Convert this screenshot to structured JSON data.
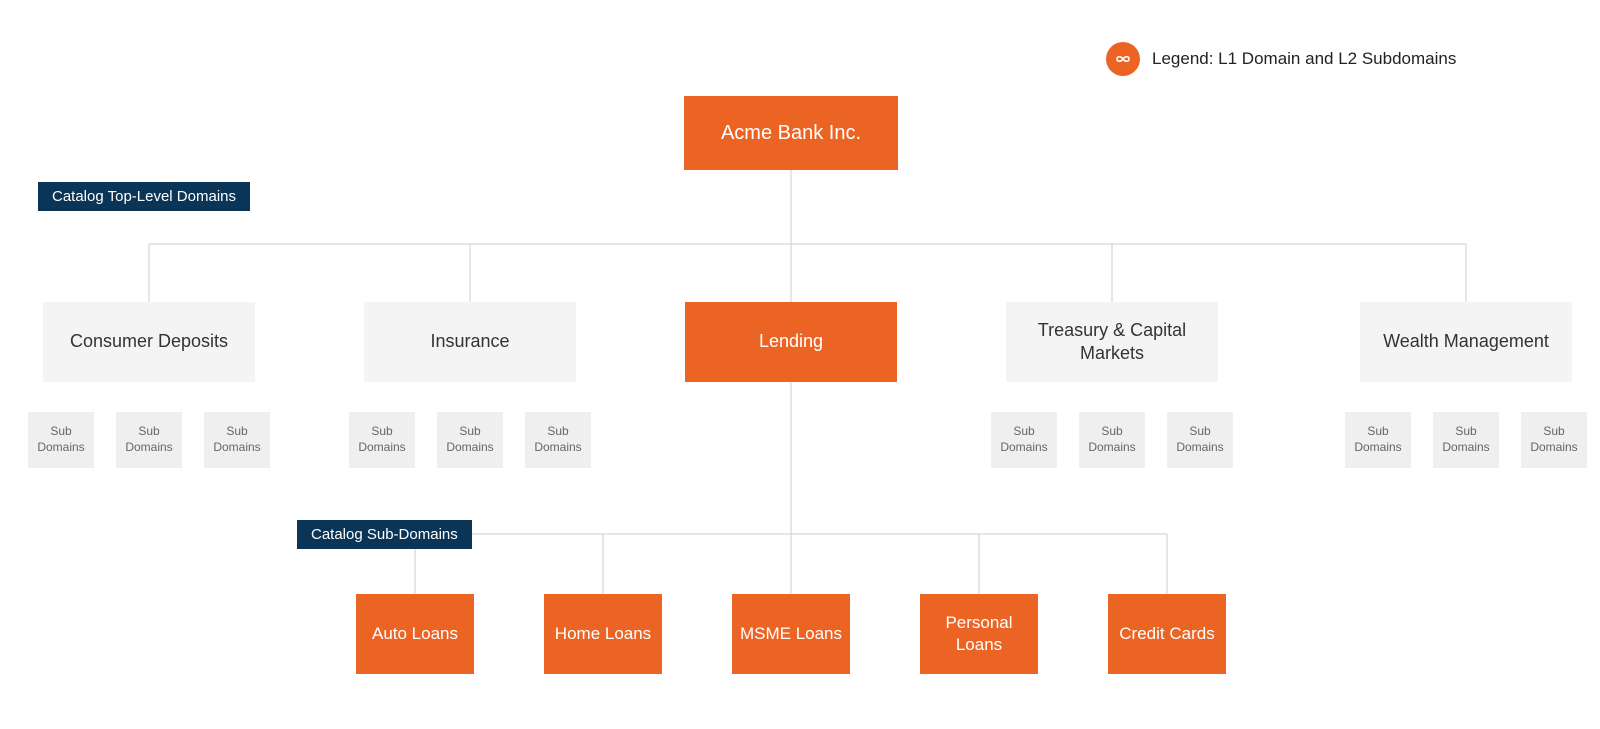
{
  "legend": {
    "text": "Legend: L1 Domain and L2 Subdomains"
  },
  "tags": {
    "top": "Catalog Top-Level Domains",
    "sub": "Catalog Sub-Domains"
  },
  "root": {
    "label": "Acme Bank Inc."
  },
  "topDomains": [
    {
      "label": "Consumer Deposits",
      "active": false
    },
    {
      "label": "Insurance",
      "active": false
    },
    {
      "label": "Lending",
      "active": true
    },
    {
      "label": "Treasury & Capital Markets",
      "active": false
    },
    {
      "label": "Wealth Management",
      "active": false
    }
  ],
  "subLabel": "Sub Domains",
  "lendingSubs": [
    {
      "label": "Auto Loans"
    },
    {
      "label": "Home Loans"
    },
    {
      "label": "MSME Loans"
    },
    {
      "label": "Personal Loans"
    },
    {
      "label": "Credit Cards"
    }
  ],
  "colors": {
    "accent": "#EB6424",
    "tagBg": "#0B3556",
    "boxBg": "#F4F4F4",
    "line": "#CCCCCC"
  }
}
